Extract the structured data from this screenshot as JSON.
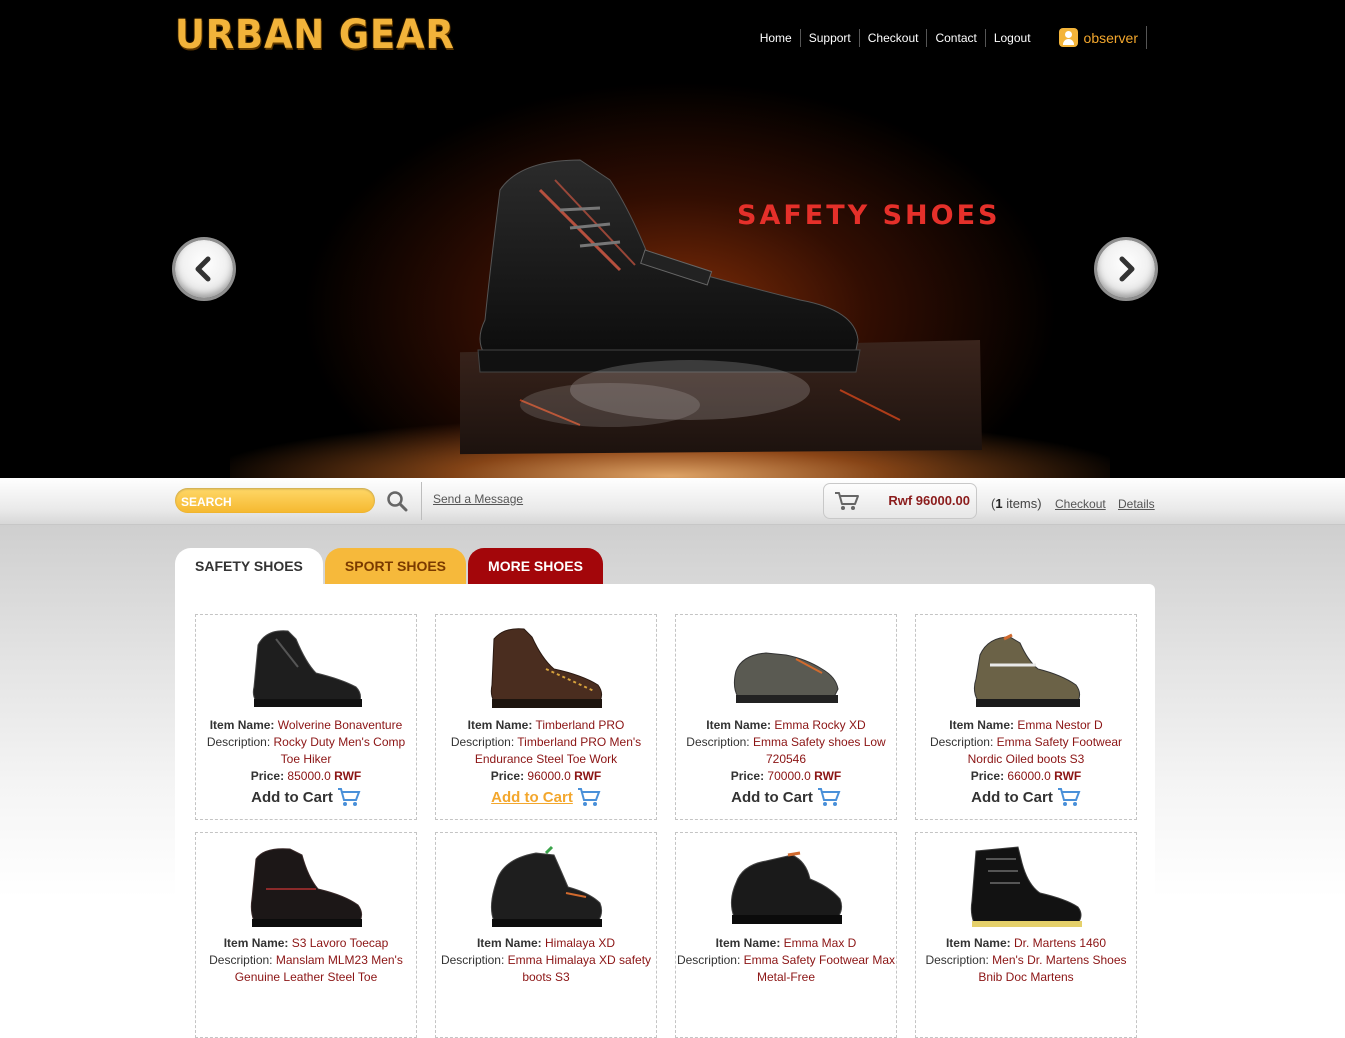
{
  "brand": {
    "logo_text": "URBAN GEAR"
  },
  "nav": {
    "links": [
      "Home",
      "Support",
      "Checkout",
      "Contact",
      "Logout"
    ],
    "user": "observer"
  },
  "hero": {
    "title": "SAFETY SHOES"
  },
  "toolbar": {
    "search_placeholder": "SEARCH",
    "send_message": "Send a Message",
    "cart_total": "Rwf 96000.00",
    "cart_count": "1",
    "cart_items_suffix": "items)",
    "cart_items_prefix": "(",
    "checkout_link": "Checkout",
    "details_link": "Details"
  },
  "tabs": [
    "SAFETY SHOES",
    "SPORT SHOES",
    "MORE SHOES"
  ],
  "labels": {
    "item_name": "Item Name:",
    "description": "Description:",
    "price": "Price:",
    "currency": "RWF",
    "add_to_cart": "Add to Cart"
  },
  "products": [
    {
      "name": "Wolverine Bonaventure",
      "description": "Rocky Duty Men's Comp Toe Hiker",
      "price": "85000.0"
    },
    {
      "name": "Timberland PRO",
      "description": "Timberland PRO Men's Endurance Steel Toe Work",
      "price": "96000.0"
    },
    {
      "name": "Emma Rocky XD",
      "description": "Emma Safety shoes Low 720546",
      "price": "70000.0"
    },
    {
      "name": "Emma Nestor D",
      "description": "Emma Safety Footwear Nordic Oiled boots S3",
      "price": "66000.0"
    },
    {
      "name": "S3 Lavoro Toecap",
      "description": "Manslam MLM23 Men's Genuine Leather Steel Toe",
      "price": ""
    },
    {
      "name": "Himalaya XD",
      "description": "Emma Himalaya XD safety boots S3",
      "price": ""
    },
    {
      "name": "Emma Max D",
      "description": "Emma Safety Footwear Max Metal-Free",
      "price": ""
    },
    {
      "name": "Dr. Martens 1460",
      "description": "Men's Dr. Martens Shoes Bnib Doc Martens",
      "price": ""
    }
  ],
  "colors": {
    "accent": "#f3a72d",
    "brand_red": "#a3060a",
    "value_red": "#8b1414"
  }
}
